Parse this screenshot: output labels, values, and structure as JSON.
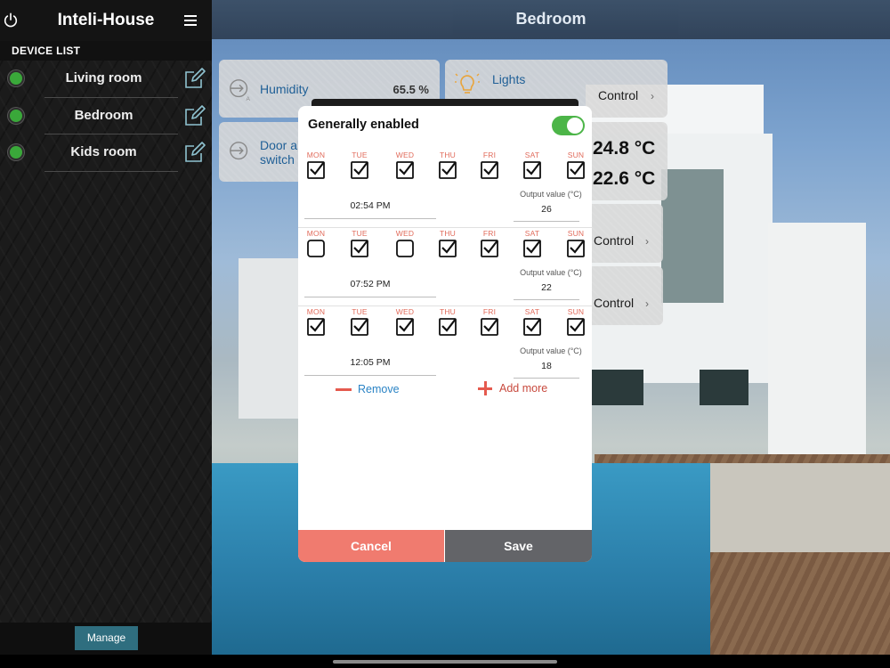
{
  "sidebar": {
    "app_title": "Inteli-House",
    "device_list_title": "DEVICE LIST",
    "devices": [
      {
        "name": "Living room",
        "status_color": "#3aa83a"
      },
      {
        "name": "Bedroom",
        "status_color": "#3aa83a"
      },
      {
        "name": "Kids room",
        "status_color": "#3aa83a"
      }
    ],
    "manage_label": "Manage",
    "icons": {
      "power": "power-icon",
      "menu": "hamburger-menu-icon",
      "edit": "edit-icon"
    }
  },
  "main": {
    "title": "Bedroom",
    "tiles": {
      "humidity": {
        "label": "Humidity",
        "value": "65.5 %"
      },
      "lights": {
        "label": "Lights",
        "control": "Control"
      },
      "door": {
        "label_line1": "Door al",
        "label_line2": "switch"
      },
      "temperature": {
        "current": "24.8 °C",
        "target": "22.6 °C"
      },
      "control_2": {
        "control": "Control"
      },
      "control_3": {
        "control": "Control"
      }
    }
  },
  "modal": {
    "header": "Generally enabled",
    "enabled": true,
    "days": [
      "MON",
      "TUE",
      "WED",
      "THU",
      "FRI",
      "SAT",
      "SUN"
    ],
    "output_label": "Output value (°C)",
    "schedules": [
      {
        "checked": [
          true,
          true,
          true,
          true,
          true,
          true,
          true
        ],
        "time": "02:54 PM",
        "output": "26"
      },
      {
        "checked": [
          false,
          true,
          false,
          true,
          true,
          true,
          true
        ],
        "time": "07:52 PM",
        "output": "22"
      },
      {
        "checked": [
          true,
          true,
          true,
          true,
          true,
          true,
          true
        ],
        "time": "12:05 PM",
        "output": "18"
      }
    ],
    "remove_label": "Remove",
    "add_more_label": "Add more",
    "cancel_label": "Cancel",
    "save_label": "Save"
  },
  "colors": {
    "accent_green": "#4cb548",
    "cancel_red": "#f07b6f",
    "save_gray": "#636468",
    "day_label": "#e16b5b",
    "link_blue": "#2a83c5",
    "manage_teal": "#2f6e7f"
  }
}
